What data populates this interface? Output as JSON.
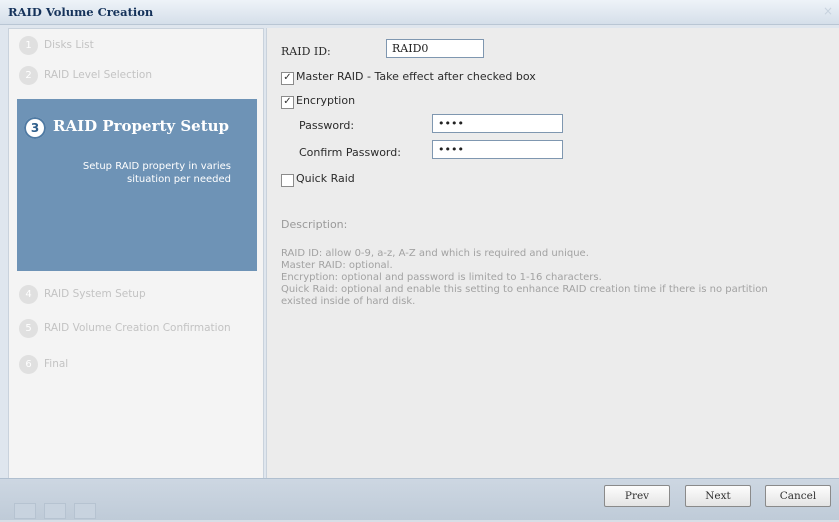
{
  "window": {
    "title": "RAID Volume Creation"
  },
  "steps": [
    {
      "num": "1",
      "label": "Disks List"
    },
    {
      "num": "2",
      "label": "RAID Level Selection"
    },
    {
      "num": "3",
      "label": "RAID Property Setup"
    },
    {
      "num": "4",
      "label": "RAID System Setup"
    },
    {
      "num": "5",
      "label": "RAID Volume Creation Confirmation"
    },
    {
      "num": "6",
      "label": "Final"
    }
  ],
  "active_step": {
    "num": "3",
    "title": "RAID Property Setup",
    "description_lines": [
      "Setup RAID property in varies",
      "situation per needed"
    ]
  },
  "form": {
    "raid_id_label": "RAID ID:",
    "raid_id_value": "RAID0",
    "master_raid_label": "Master RAID - Take effect after checked box",
    "master_raid_checked": true,
    "encryption_label": "Encryption",
    "encryption_checked": true,
    "password_label": "Password:",
    "password_value": "••••",
    "confirm_password_label": "Confirm Password:",
    "confirm_password_value": "••••",
    "quick_raid_label": "Quick Raid",
    "quick_raid_checked": false
  },
  "description": {
    "title": "Description:",
    "lines": [
      "RAID ID: allow 0-9, a-z, A-Z and which is required and unique.",
      "Master RAID: optional.",
      "Encryption: optional and password is limited to 1-16 characters.",
      "Quick Raid: optional and enable this setting to enhance RAID creation time if there is no partition",
      "existed inside of hard disk."
    ]
  },
  "buttons": {
    "prev": "Prev",
    "next": "Next",
    "cancel": "Cancel"
  },
  "icons": {
    "checkbox_checked": "✓",
    "close": "×"
  },
  "colors": {
    "active_step_bg": "#6e93b6",
    "window_bg": "#dfe6ee"
  }
}
